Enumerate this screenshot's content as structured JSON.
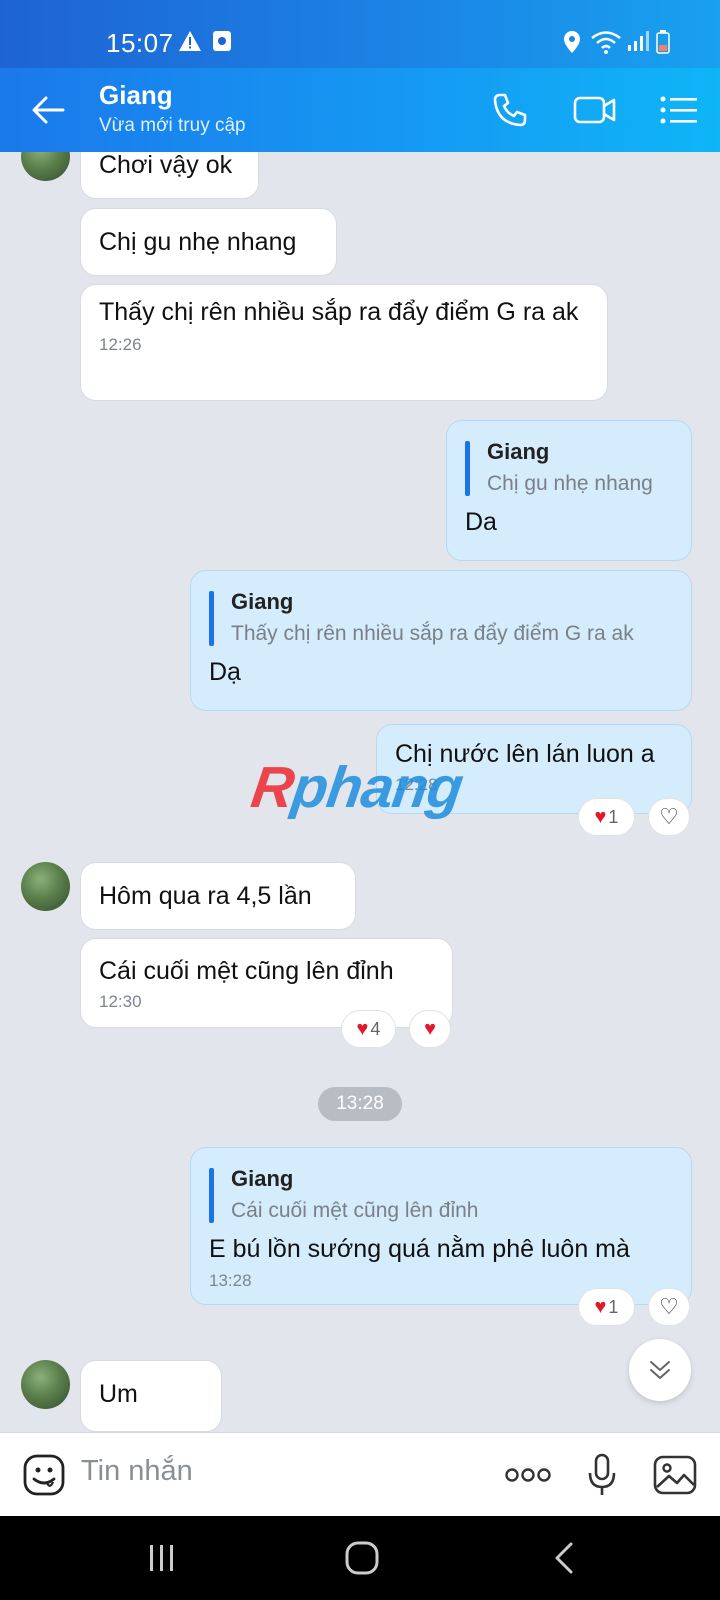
{
  "status_bar": {
    "time": "15:07",
    "icons": [
      "alert-triangle-icon",
      "media-icon",
      "location-icon",
      "wifi-icon",
      "signal-icon",
      "battery-icon"
    ]
  },
  "header": {
    "contact_name": "Giang",
    "status": "Vừa mới truy cập",
    "back_icon": "back-arrow-icon",
    "call_icon": "phone-icon",
    "video_icon": "video-camera-icon",
    "menu_icon": "list-menu-icon",
    "colors": {
      "gradient_start": "#1b79ea",
      "gradient_end": "#0fb5f7"
    }
  },
  "messages": [
    {
      "from": "them",
      "text": "Chơi vậy ok"
    },
    {
      "from": "them",
      "text": "Chị gu nhẹ nhang"
    },
    {
      "from": "them",
      "text": "Thấy chị rên nhiều sắp ra đẩy điểm G ra ak",
      "time": "12:26"
    },
    {
      "from": "me",
      "quote_name": "Giang",
      "quote_text": "Chị gu nhẹ nhang",
      "text": "Da"
    },
    {
      "from": "me",
      "quote_name": "Giang",
      "quote_text": "Thấy chị rên nhiều sắp ra đẩy điểm G ra ak",
      "text": "Dạ"
    },
    {
      "from": "me",
      "text": "Chị nước lên lán luon a",
      "time": "12:28",
      "reaction_count": "1"
    },
    {
      "from": "them",
      "text": "Hôm qua ra 4,5 lần"
    },
    {
      "from": "them",
      "text": "Cái cuối mệt cũng lên đỉnh",
      "time": "12:30",
      "reaction_count": "4"
    },
    {
      "from": "me",
      "quote_name": "Giang",
      "quote_text": "Cái cuối mệt cũng lên đỉnh",
      "text": "E bú lồn sướng quá nằm phê luôn mà",
      "time": "13:28",
      "reaction_count": "1"
    },
    {
      "from": "them",
      "text": "Um"
    }
  ],
  "time_divider": "13:28",
  "watermark": {
    "r": "R",
    "rest": "phang"
  },
  "input": {
    "placeholder": "Tin nhắn",
    "emoji_icon": "emoji-icon",
    "more_icon": "more-dots-icon",
    "mic_icon": "microphone-icon",
    "image_icon": "image-icon"
  },
  "nav": [
    "recent-apps-icon",
    "home-icon",
    "back-icon"
  ],
  "colors": {
    "chat_bg": "#e2e6ec",
    "outgoing_bubble": "#d4ecfc",
    "heart": "#e3192b"
  }
}
